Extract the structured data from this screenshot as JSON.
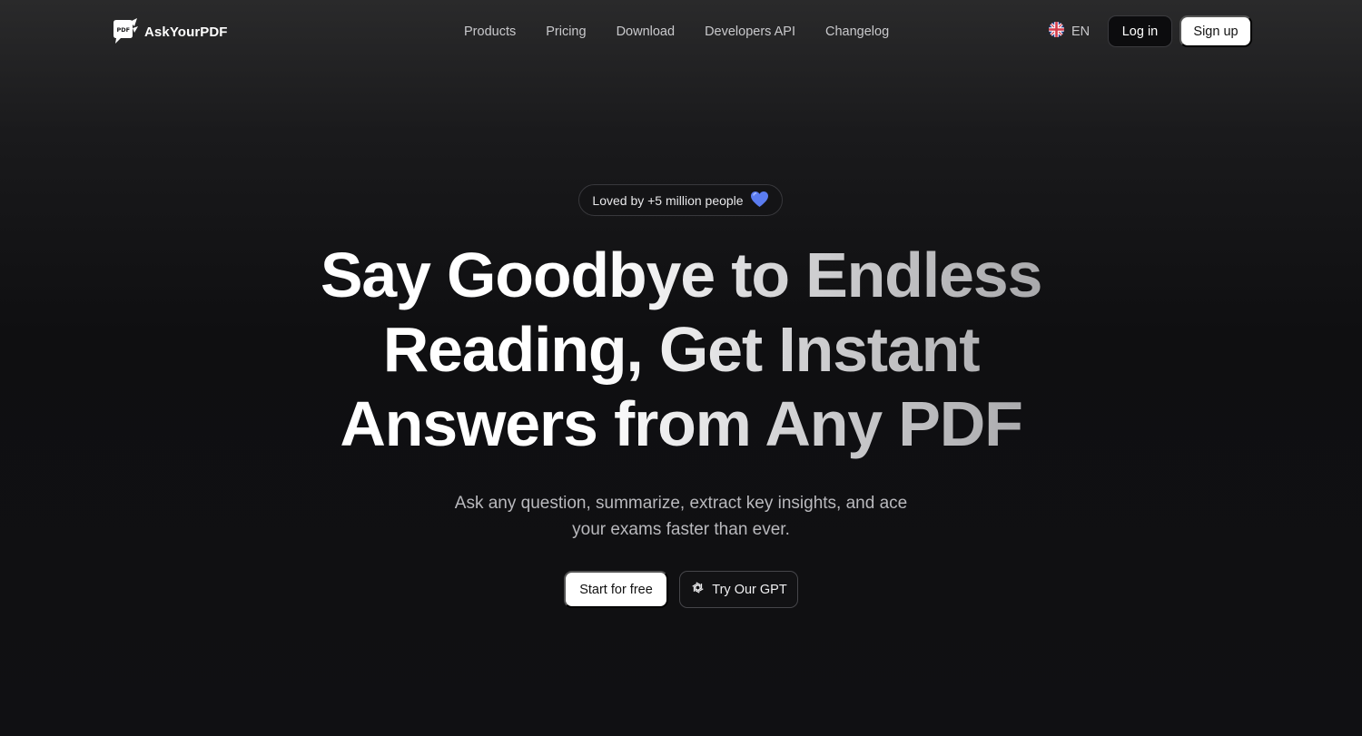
{
  "brand": {
    "name": "AskYourPDF",
    "logo_icon": "pdf-speech-bubble-icon",
    "logo_badge": "PDF"
  },
  "nav": {
    "links": [
      "Products",
      "Pricing",
      "Download",
      "Developers API",
      "Changelog"
    ],
    "language": {
      "code": "EN",
      "flag_icon": "uk-flag-icon"
    },
    "login_label": "Log in",
    "signup_label": "Sign up"
  },
  "hero": {
    "badge_text": "Loved by +5 million people",
    "badge_icon": "blue-heart-icon",
    "headline_lines": [
      "Say Goodbye to Endless",
      "Reading, Get Instant",
      "Answers from Any PDF"
    ],
    "subtitle_lines": [
      "Ask any question, summarize, extract key insights, and ace",
      "your exams faster than ever."
    ],
    "primary_cta": "Start for free",
    "secondary_cta": "Try Our GPT",
    "secondary_cta_icon": "openai-logo-icon"
  },
  "colors": {
    "background": "#0f0f11",
    "accent_heart": "#5b7cf0",
    "primary_button": "#ffffff"
  }
}
